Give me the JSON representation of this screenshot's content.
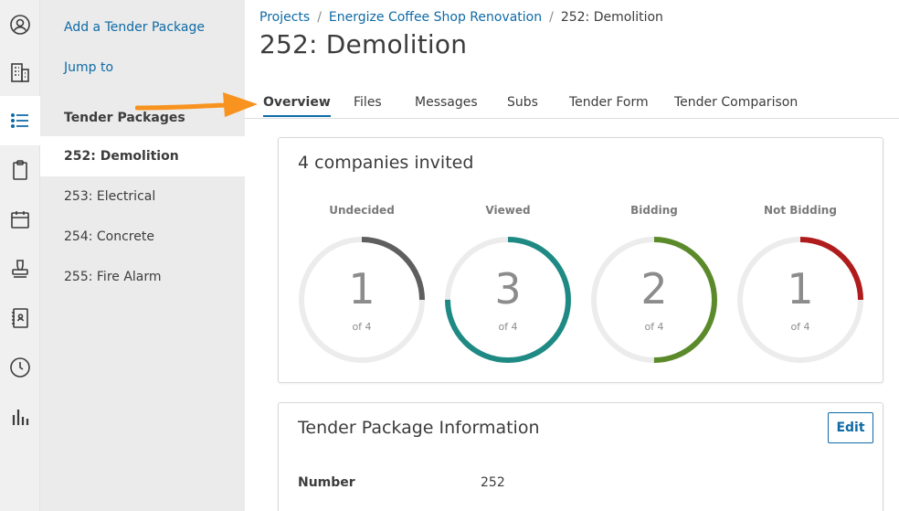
{
  "rail": {
    "icons": [
      "user-circle-icon",
      "building-icon",
      "list-icon",
      "clipboard-icon",
      "calendar-icon",
      "stamp-icon",
      "contacts-book-icon",
      "clock-icon",
      "bar-chart-icon"
    ],
    "active_index": 2
  },
  "sidebar": {
    "add_link": "Add a Tender Package",
    "jump_link": "Jump to",
    "heading": "Tender Packages",
    "items": [
      {
        "label": "252: Demolition",
        "active": true
      },
      {
        "label": "253: Electrical",
        "active": false
      },
      {
        "label": "254: Concrete",
        "active": false
      },
      {
        "label": "255: Fire Alarm",
        "active": false
      }
    ]
  },
  "breadcrumb": {
    "projects": "Projects",
    "sep": "/",
    "project": "Energize Coffee Shop Renovation",
    "current": "252: Demolition"
  },
  "page_title": "252: Demolition",
  "tabs": [
    "Overview",
    "Files",
    "Messages",
    "Subs",
    "Tender Form",
    "Tender Comparison"
  ],
  "active_tab": "Overview",
  "invited_card": {
    "title": "4 companies invited",
    "gauges": [
      {
        "label": "Undecided",
        "value": "1",
        "of": "of 4",
        "fraction": 0.25,
        "color": "#5f5f5f"
      },
      {
        "label": "Viewed",
        "value": "3",
        "of": "of 4",
        "fraction": 0.75,
        "color": "#1f8a84"
      },
      {
        "label": "Bidding",
        "value": "2",
        "of": "of 4",
        "fraction": 0.5,
        "color": "#5b8a2a"
      },
      {
        "label": "Not Bidding",
        "value": "1",
        "of": "of 4",
        "fraction": 0.25,
        "color": "#b01c1c"
      }
    ]
  },
  "info_card": {
    "title": "Tender Package Information",
    "edit_label": "Edit",
    "number_label": "Number",
    "number_value": "252"
  },
  "colors": {
    "accent": "#0e6aa6",
    "arrow": "#f7931e",
    "track": "#ececec"
  }
}
